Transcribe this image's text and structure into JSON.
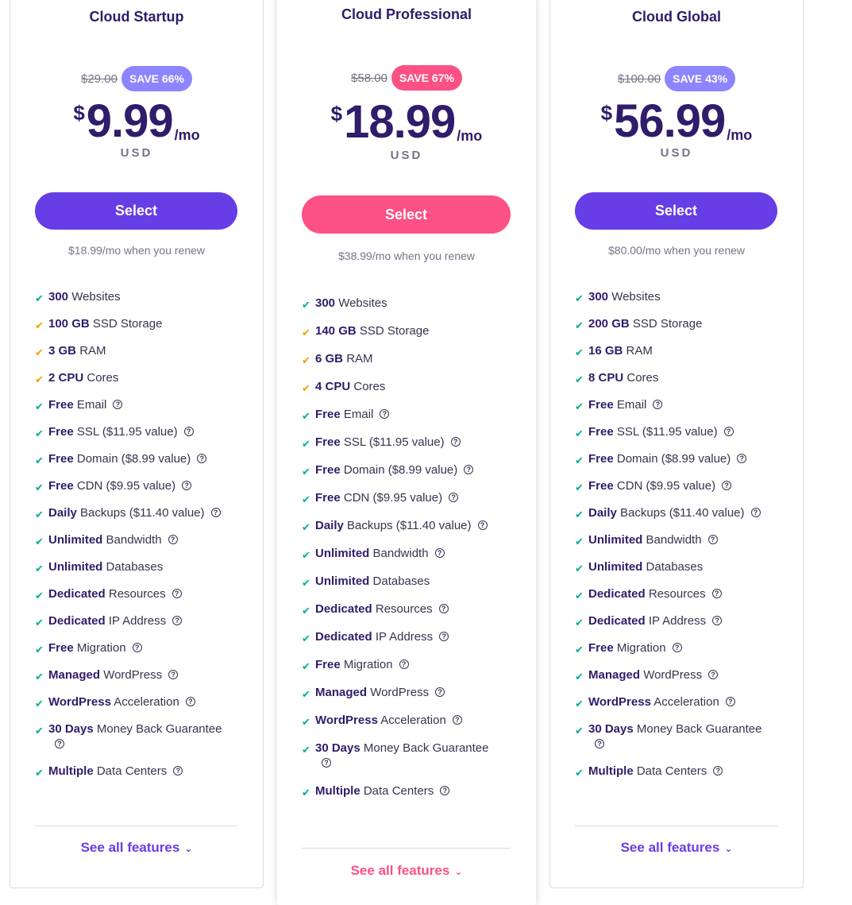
{
  "plans": [
    {
      "title": "Cloud Startup",
      "old_price": "$29.00",
      "save": "SAVE 66%",
      "currency": "$",
      "amount": "9.99",
      "per": "/mo",
      "usd": "USD",
      "select_label": "Select",
      "renew": "$18.99/mo when you renew",
      "see_all": "See all features",
      "theme": "purple",
      "features": [
        {
          "bold": "300",
          "text": "Websites",
          "check": "green",
          "help": false
        },
        {
          "bold": "100 GB",
          "text": "SSD Storage",
          "check": "orange",
          "help": false
        },
        {
          "bold": "3 GB",
          "text": "RAM",
          "check": "orange",
          "help": false
        },
        {
          "bold": "2 CPU",
          "text": "Cores",
          "check": "orange",
          "help": false
        },
        {
          "bold": "Free",
          "text": "Email",
          "check": "green",
          "help": true
        },
        {
          "bold": "Free",
          "text": "SSL ($11.95 value)",
          "check": "green",
          "help": true
        },
        {
          "bold": "Free",
          "text": "Domain ($8.99 value)",
          "check": "green",
          "help": true
        },
        {
          "bold": "Free",
          "text": "CDN ($9.95 value)",
          "check": "green",
          "help": true
        },
        {
          "bold": "Daily",
          "text": "Backups ($11.40 value)",
          "check": "green",
          "help": true
        },
        {
          "bold": "Unlimited",
          "text": "Bandwidth",
          "check": "green",
          "help": true
        },
        {
          "bold": "Unlimited",
          "text": "Databases",
          "check": "green",
          "help": false
        },
        {
          "bold": "Dedicated",
          "text": "Resources",
          "check": "green",
          "help": true
        },
        {
          "bold": "Dedicated",
          "text": "IP Address",
          "check": "green",
          "help": true
        },
        {
          "bold": "Free",
          "text": "Migration",
          "check": "green",
          "help": true
        },
        {
          "bold": "Managed",
          "text": "WordPress",
          "check": "green",
          "help": true
        },
        {
          "bold": "WordPress",
          "text": "Acceleration",
          "check": "green",
          "help": true
        },
        {
          "bold": "30 Days",
          "text": "Money Back Guarantee",
          "check": "green",
          "help": true
        },
        {
          "bold": "Multiple",
          "text": "Data Centers",
          "check": "green",
          "help": true
        }
      ]
    },
    {
      "title": "Cloud Professional",
      "old_price": "$58.00",
      "save": "SAVE 67%",
      "currency": "$",
      "amount": "18.99",
      "per": "/mo",
      "usd": "USD",
      "select_label": "Select",
      "renew": "$38.99/mo when you renew",
      "see_all": "See all features",
      "theme": "pink",
      "features": [
        {
          "bold": "300",
          "text": "Websites",
          "check": "green",
          "help": false
        },
        {
          "bold": "140 GB",
          "text": "SSD Storage",
          "check": "orange",
          "help": false
        },
        {
          "bold": "6 GB",
          "text": "RAM",
          "check": "orange",
          "help": false
        },
        {
          "bold": "4 CPU",
          "text": "Cores",
          "check": "orange",
          "help": false
        },
        {
          "bold": "Free",
          "text": "Email",
          "check": "green",
          "help": true
        },
        {
          "bold": "Free",
          "text": "SSL ($11.95 value)",
          "check": "green",
          "help": true
        },
        {
          "bold": "Free",
          "text": "Domain ($8.99 value)",
          "check": "green",
          "help": true
        },
        {
          "bold": "Free",
          "text": "CDN ($9.95 value)",
          "check": "green",
          "help": true
        },
        {
          "bold": "Daily",
          "text": "Backups ($11.40 value)",
          "check": "green",
          "help": true
        },
        {
          "bold": "Unlimited",
          "text": "Bandwidth",
          "check": "green",
          "help": true
        },
        {
          "bold": "Unlimited",
          "text": "Databases",
          "check": "green",
          "help": false
        },
        {
          "bold": "Dedicated",
          "text": "Resources",
          "check": "green",
          "help": true
        },
        {
          "bold": "Dedicated",
          "text": "IP Address",
          "check": "green",
          "help": true
        },
        {
          "bold": "Free",
          "text": "Migration",
          "check": "green",
          "help": true
        },
        {
          "bold": "Managed",
          "text": "WordPress",
          "check": "green",
          "help": true
        },
        {
          "bold": "WordPress",
          "text": "Acceleration",
          "check": "green",
          "help": true
        },
        {
          "bold": "30 Days",
          "text": "Money Back Guarantee",
          "check": "green",
          "help": true
        },
        {
          "bold": "Multiple",
          "text": "Data Centers",
          "check": "green",
          "help": true
        }
      ]
    },
    {
      "title": "Cloud Global",
      "old_price": "$100.00",
      "save": "SAVE 43%",
      "currency": "$",
      "amount": "56.99",
      "per": "/mo",
      "usd": "USD",
      "select_label": "Select",
      "renew": "$80.00/mo when you renew",
      "see_all": "See all features",
      "theme": "purple",
      "features": [
        {
          "bold": "300",
          "text": "Websites",
          "check": "green",
          "help": false
        },
        {
          "bold": "200 GB",
          "text": "SSD Storage",
          "check": "green",
          "help": false
        },
        {
          "bold": "16 GB",
          "text": "RAM",
          "check": "green",
          "help": false
        },
        {
          "bold": "8 CPU",
          "text": "Cores",
          "check": "green",
          "help": false
        },
        {
          "bold": "Free",
          "text": "Email",
          "check": "green",
          "help": true
        },
        {
          "bold": "Free",
          "text": "SSL ($11.95 value)",
          "check": "green",
          "help": true
        },
        {
          "bold": "Free",
          "text": "Domain ($8.99 value)",
          "check": "green",
          "help": true
        },
        {
          "bold": "Free",
          "text": "CDN ($9.95 value)",
          "check": "green",
          "help": true
        },
        {
          "bold": "Daily",
          "text": "Backups ($11.40 value)",
          "check": "green",
          "help": true
        },
        {
          "bold": "Unlimited",
          "text": "Bandwidth",
          "check": "green",
          "help": true
        },
        {
          "bold": "Unlimited",
          "text": "Databases",
          "check": "green",
          "help": false
        },
        {
          "bold": "Dedicated",
          "text": "Resources",
          "check": "green",
          "help": true
        },
        {
          "bold": "Dedicated",
          "text": "IP Address",
          "check": "green",
          "help": true
        },
        {
          "bold": "Free",
          "text": "Migration",
          "check": "green",
          "help": true
        },
        {
          "bold": "Managed",
          "text": "WordPress",
          "check": "green",
          "help": true
        },
        {
          "bold": "WordPress",
          "text": "Acceleration",
          "check": "green",
          "help": true
        },
        {
          "bold": "30 Days",
          "text": "Money Back Guarantee",
          "check": "green",
          "help": true
        },
        {
          "bold": "Multiple",
          "text": "Data Centers",
          "check": "green",
          "help": true
        }
      ]
    }
  ],
  "colors": {
    "purple": "#673de6",
    "pink": "#fc5185",
    "badge_purple": "#8c85ff",
    "check_green": "#00b090",
    "check_orange": "#f0a000",
    "heading": "#2f1c6a"
  },
  "icons": {
    "check": "check-icon",
    "help": "question-circle-icon",
    "chevron": "chevron-down-icon"
  }
}
